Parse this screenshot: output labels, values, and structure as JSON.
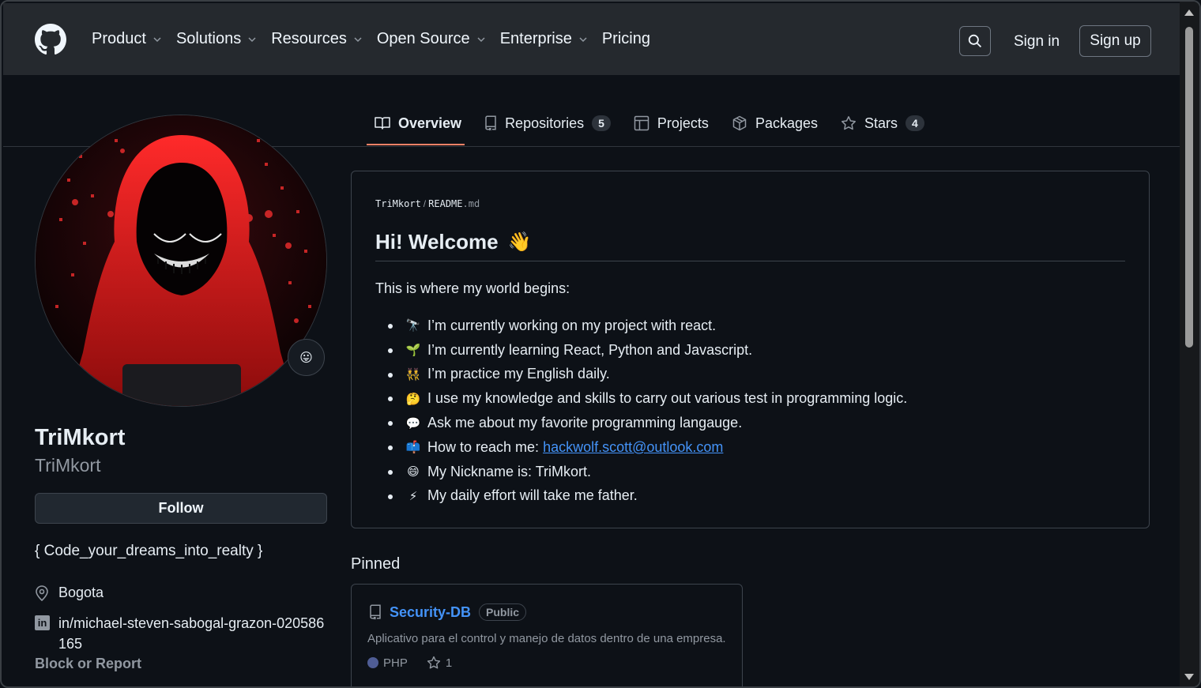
{
  "header": {
    "nav": [
      {
        "label": "Product",
        "has_menu": true
      },
      {
        "label": "Solutions",
        "has_menu": true
      },
      {
        "label": "Resources",
        "has_menu": true
      },
      {
        "label": "Open Source",
        "has_menu": true
      },
      {
        "label": "Enterprise",
        "has_menu": true
      },
      {
        "label": "Pricing",
        "has_menu": false
      }
    ],
    "sign_in": "Sign in",
    "sign_up": "Sign up"
  },
  "tabs": [
    {
      "label": "Overview",
      "icon": "book-icon",
      "active": true
    },
    {
      "label": "Repositories",
      "icon": "repo-icon",
      "count": "5"
    },
    {
      "label": "Projects",
      "icon": "table-icon"
    },
    {
      "label": "Packages",
      "icon": "package-icon"
    },
    {
      "label": "Stars",
      "icon": "star-icon",
      "count": "4"
    }
  ],
  "profile": {
    "name": "TriMkort",
    "login": "TriMkort",
    "status_emoji": "😛",
    "follow": "Follow",
    "bio": "{ Code_your_dreams_into_realty }",
    "location": "Bogota",
    "linkedin": "in/michael-steven-sabogal-grazon-020586165",
    "block_report": "Block or Report"
  },
  "readme": {
    "path_user": "TriMkort",
    "path_sep": "/",
    "path_file": "README",
    "path_ext": ".md",
    "title": "Hi! Welcome",
    "title_emoji": "👋",
    "intro": "This is where my world begins:",
    "items": [
      {
        "emoji": "🔭",
        "text": "I’m currently working on my project with react."
      },
      {
        "emoji": "🌱",
        "text": "I’m currently learning React, Python and Javascript."
      },
      {
        "emoji": "👯",
        "text": "I’m practice my English daily."
      },
      {
        "emoji": "🤔",
        "text": "I use my knowledge and skills to carry out various test in programming logic."
      },
      {
        "emoji": "💬",
        "text": "Ask me about my favorite programming langauge."
      },
      {
        "emoji": "📫",
        "text": "How to reach me: ",
        "link": "hackwolf.scott@outlook.com"
      },
      {
        "emoji": "😄",
        "text": "My Nickname is: TriMkort."
      },
      {
        "emoji": "⚡",
        "text": "My daily effort will take me father."
      }
    ]
  },
  "pinned": {
    "label": "Pinned",
    "repos": [
      {
        "name": "Security-DB",
        "visibility": "Public",
        "description": "Aplicativo para el control y manejo de datos dentro de una empresa.",
        "language": "PHP",
        "language_color": "#4f5d95",
        "stars": "1"
      }
    ]
  },
  "colors": {
    "background": "#0d1117",
    "header": "#25292e",
    "link": "#4493f8",
    "tab_accent": "#f78166"
  }
}
